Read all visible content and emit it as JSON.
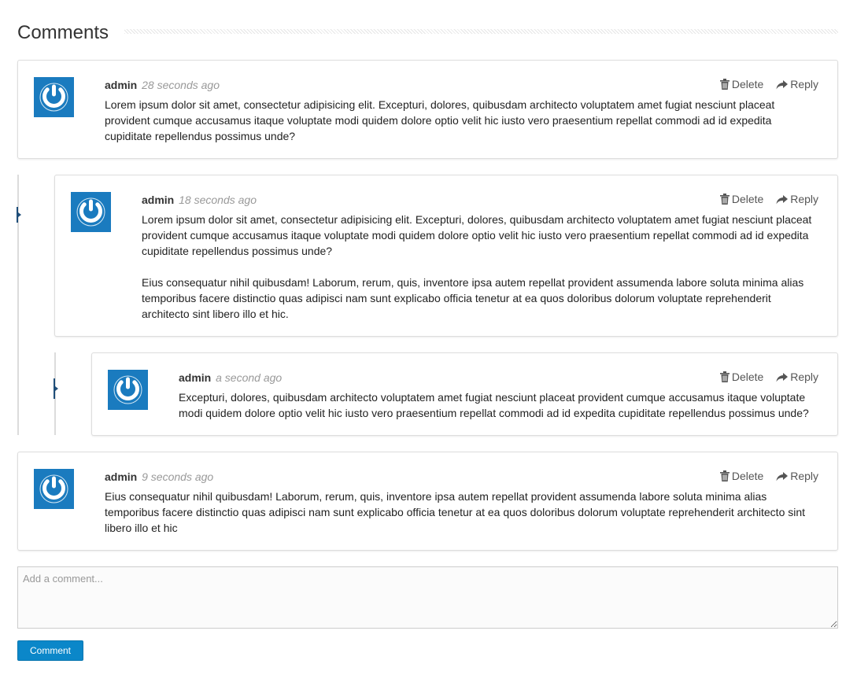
{
  "header": {
    "title": "Comments"
  },
  "actions": {
    "delete_label": "Delete",
    "reply_label": "Reply"
  },
  "comments": [
    {
      "author": "admin",
      "time": "28 seconds ago",
      "paragraphs": [
        "Lorem ipsum dolor sit amet, consectetur adipisicing elit. Excepturi, dolores, quibusdam architecto voluptatem amet fugiat nesciunt placeat provident cumque accusamus itaque voluptate modi quidem dolore optio velit hic iusto vero praesentium repellat commodi ad id expedita cupiditate repellendus possimus unde?"
      ]
    },
    {
      "author": "admin",
      "time": "18 seconds ago",
      "paragraphs": [
        "Lorem ipsum dolor sit amet, consectetur adipisicing elit. Excepturi, dolores, quibusdam architecto voluptatem amet fugiat nesciunt placeat provident cumque accusamus itaque voluptate modi quidem dolore optio velit hic iusto vero praesentium repellat commodi ad id expedita cupiditate repellendus possimus unde?",
        "Eius consequatur nihil quibusdam! Laborum, rerum, quis, inventore ipsa autem repellat provident assumenda labore soluta minima alias temporibus facere distinctio quas adipisci nam sunt explicabo officia tenetur at ea quos doloribus dolorum voluptate reprehenderit architecto sint libero illo et hic."
      ]
    },
    {
      "author": "admin",
      "time": "a second ago",
      "paragraphs": [
        "Excepturi, dolores, quibusdam architecto voluptatem amet fugiat nesciunt placeat provident cumque accusamus itaque voluptate modi quidem dolore optio velit hic iusto vero praesentium repellat commodi ad id expedita cupiditate repellendus possimus unde?"
      ]
    },
    {
      "author": "admin",
      "time": "9 seconds ago",
      "paragraphs": [
        "Eius consequatur nihil quibusdam! Laborum, rerum, quis, inventore ipsa autem repellat provident assumenda labore soluta minima alias temporibus facere distinctio quas adipisci nam sunt explicabo officia tenetur at ea quos doloribus dolorum voluptate reprehenderit architecto sint libero illo et hic"
      ]
    }
  ],
  "composer": {
    "placeholder": "Add a comment...",
    "value": "",
    "submit_label": "Comment"
  },
  "colors": {
    "accent": "#0b87c9",
    "avatar_bg": "#1a7bbf",
    "thread_line": "#dcdcdc",
    "thread_marker": "#1f4e79"
  },
  "icons": {
    "avatar": "power-icon",
    "delete": "trash-icon",
    "reply": "share-arrow-icon"
  }
}
